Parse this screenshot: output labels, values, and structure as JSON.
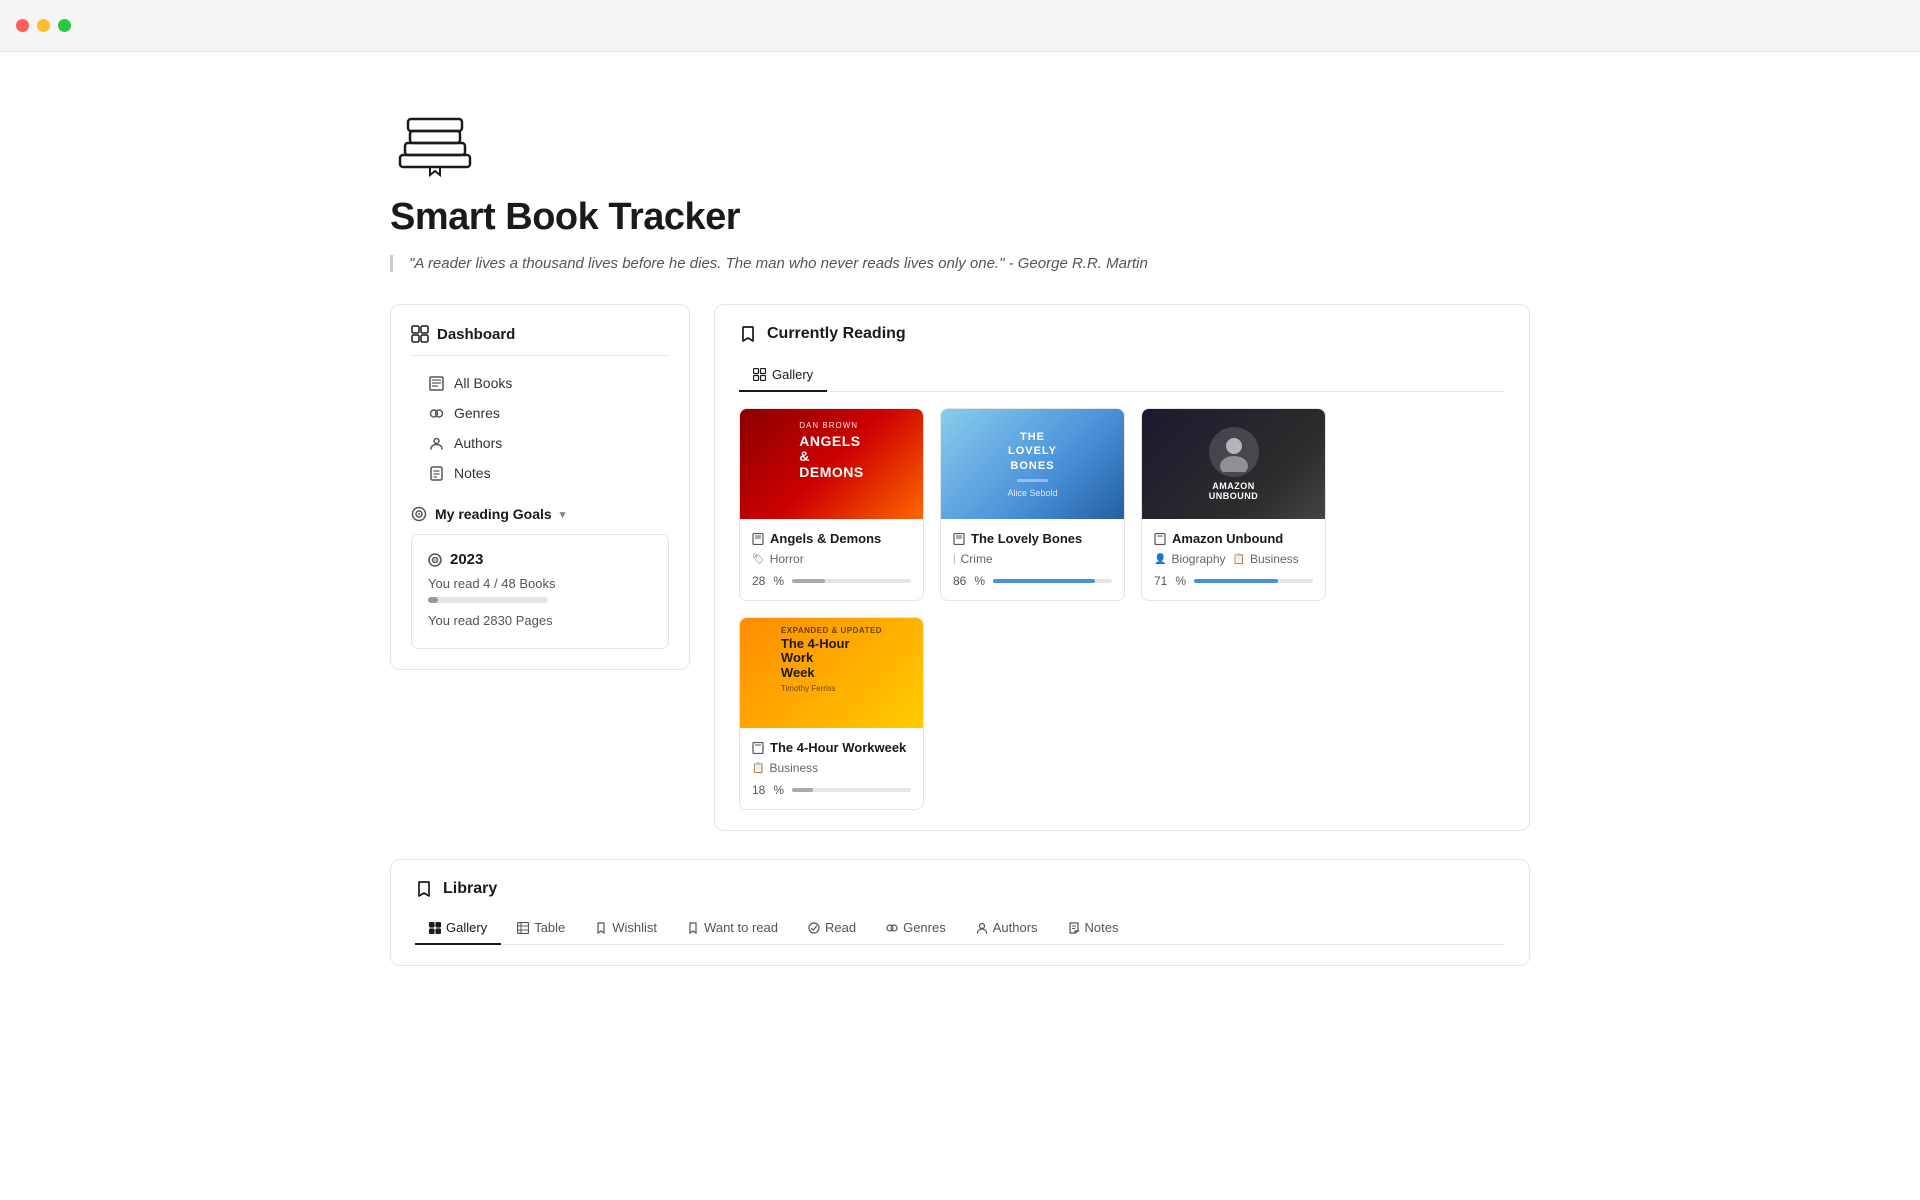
{
  "app": {
    "title": "Smart Book Tracker",
    "quote": "\"A reader lives a thousand lives before he dies. The man who never reads lives only one.\" - George R.R. Martin"
  },
  "titlebar": {
    "buttons": [
      "close",
      "minimize",
      "maximize"
    ]
  },
  "sidebar": {
    "section_title": "Dashboard",
    "nav_items": [
      {
        "id": "all-books",
        "label": "All Books",
        "icon": "📖"
      },
      {
        "id": "genres",
        "label": "Genres",
        "icon": "🏷"
      },
      {
        "id": "authors",
        "label": "Authors",
        "icon": "👤"
      },
      {
        "id": "notes",
        "label": "Notes",
        "icon": "📝"
      }
    ],
    "goals_title": "My reading Goals",
    "goals_year": "2023",
    "goals_books_read": "You read 4 / 48 Books",
    "goals_progress_pct": "8%",
    "goals_pages": "You read 2830 Pages"
  },
  "currently_reading": {
    "section_title": "Currently Reading",
    "active_tab": "Gallery",
    "tabs": [
      {
        "id": "gallery",
        "label": "Gallery"
      }
    ],
    "books": [
      {
        "id": "angels-demons",
        "title": "Angels & Demons",
        "genre": "Horror",
        "progress": 28,
        "cover_style": "cover-angels"
      },
      {
        "id": "lovely-bones",
        "title": "The Lovely Bones",
        "genre": "Crime",
        "progress": 86,
        "cover_style": "cover-bones"
      },
      {
        "id": "amazon-unbound",
        "title": "Amazon Unbound",
        "genre1": "Biography",
        "genre2": "Business",
        "progress": 71,
        "cover_style": "cover-amazon"
      },
      {
        "id": "four-hour-workweek",
        "title": "The 4-Hour Workweek",
        "genre": "Business",
        "progress": 18,
        "cover_style": "cover-workweek"
      }
    ]
  },
  "library": {
    "section_title": "Library",
    "active_tab": "Gallery",
    "tabs": [
      {
        "id": "gallery",
        "label": "Gallery"
      },
      {
        "id": "table",
        "label": "Table"
      },
      {
        "id": "wishlist",
        "label": "Wishlist"
      },
      {
        "id": "want-to-read",
        "label": "Want to read"
      },
      {
        "id": "read",
        "label": "Read"
      },
      {
        "id": "genres",
        "label": "Genres"
      },
      {
        "id": "authors",
        "label": "Authors"
      },
      {
        "id": "notes",
        "label": "Notes"
      }
    ]
  },
  "icons": {
    "bookmark": "🔖",
    "dashboard": "⊞",
    "book": "📖",
    "tag": "🏷",
    "person": "👤",
    "note": "📝",
    "goal": "🎯",
    "gallery": "⊞",
    "table": "📋",
    "wishlist": "🔖",
    "pencil": "✏️",
    "chevron": "⌄"
  }
}
